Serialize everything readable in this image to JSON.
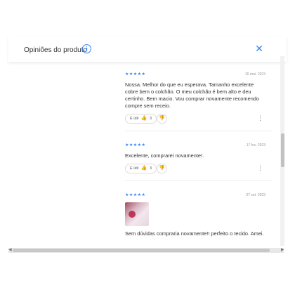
{
  "header": {
    "title": "Opiniões do produto",
    "info_icon": "info-circle-icon",
    "close_icon": "close-x-icon",
    "accent_color": "#3483fa"
  },
  "reviews": [
    {
      "stars": "★★★★★",
      "rating": 5,
      "date": "26 mai. 2023",
      "text": "Nossa. Melhor do que eu esperava. Tamanho excelente cobre bem o colchão. O meu colchão é bem alto e deu certinho. Bem macio. Vou comprar novamente recomendo compre sem receio.",
      "useful_label": "É útil",
      "useful_count": "3"
    },
    {
      "stars": "★★★★★",
      "rating": 5,
      "date": "17 fev. 2023",
      "text": "Excelente, comprarei novamente!.",
      "useful_label": "É útil",
      "useful_count": "3"
    },
    {
      "stars": "★★★★★",
      "rating": 5,
      "date": "07 set. 2023",
      "text": "Sem dúvidas compraria novamente!! perfeito o tecido. Amei.",
      "has_photo": true
    }
  ]
}
